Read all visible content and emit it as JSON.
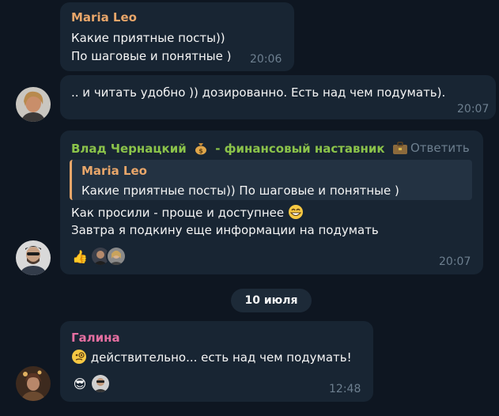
{
  "messages": {
    "m1": {
      "author": "Maria Leo",
      "lines": [
        "Какие приятные посты))",
        "По шаговые и понятные )"
      ],
      "time": "20:06"
    },
    "m2": {
      "text": ".. и читать удобно )) дозированно. Есть над чем подумать).",
      "time": "20:07"
    },
    "m3": {
      "author": "Влад Чернацкий",
      "author_suffix": " - финансовый наставник",
      "reply_label": "Ответить",
      "quote": {
        "author": "Maria Leo",
        "text": "Какие приятные посты))  По шаговые и понятные )"
      },
      "line1": "Как просили - проще и доступнее",
      "line2": "Завтра я подкину еще информации на подумать",
      "time": "20:07",
      "reaction_emoji": "👍"
    },
    "date_separator": "10 июля",
    "m4": {
      "author": "Галина",
      "text": "действительно... есть над чем подумать!",
      "time": "12:48",
      "reaction_emoji": "😎"
    }
  },
  "colors": {
    "bg": "#0e1621",
    "bubble": "#182533",
    "maria_name": "#e8a66a",
    "vlad_name": "#8bc34a",
    "galina_name": "#e56fa1",
    "timestamp": "#6d7f8f"
  },
  "icons": {
    "money_bag": "money-bag-icon",
    "briefcase": "briefcase-icon",
    "grin": "grinning-face-icon",
    "thinking": "face-with-monocle-icon",
    "thumbs_up": "thumbs-up-icon",
    "sunglasses": "sunglasses-face-icon"
  }
}
